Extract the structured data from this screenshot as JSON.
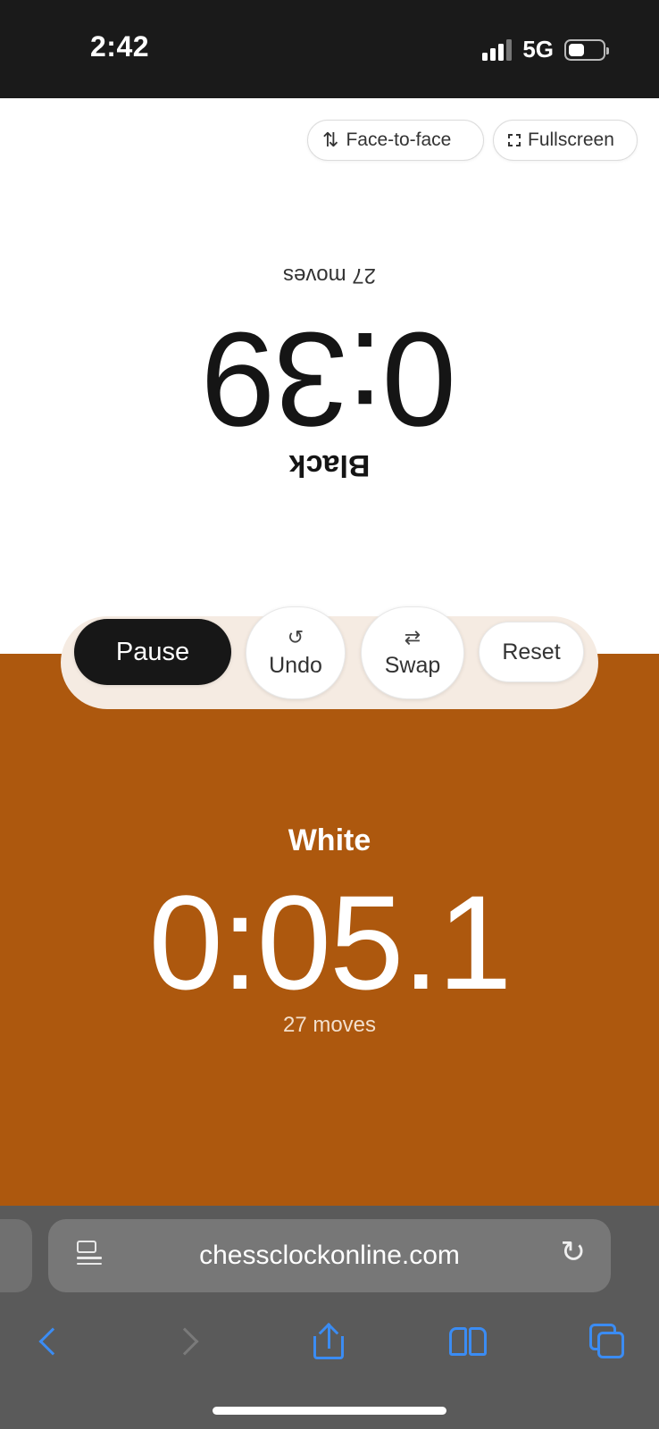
{
  "status_bar": {
    "time": "2:42",
    "network": "5G",
    "battery_level": 0.45
  },
  "toolbar": {
    "face_to_face_label": "Face-to-face",
    "fullscreen_label": "Fullscreen"
  },
  "black_player": {
    "name": "Black",
    "time": "0:39",
    "moves": "27 moves",
    "text_color": "#151515"
  },
  "controls": {
    "pause_label": "Pause",
    "undo_label": "Undo",
    "swap_label": "Swap",
    "reset_label": "Reset"
  },
  "white_player": {
    "name": "White",
    "time": "0:05.1",
    "moves": "27 moves",
    "background_color": "#ad580e"
  },
  "browser": {
    "url": "chessclockonline.com",
    "icons": [
      "reader-icon",
      "reload-icon",
      "back-icon",
      "forward-icon",
      "share-icon",
      "bookmarks-icon",
      "tabs-icon"
    ]
  }
}
